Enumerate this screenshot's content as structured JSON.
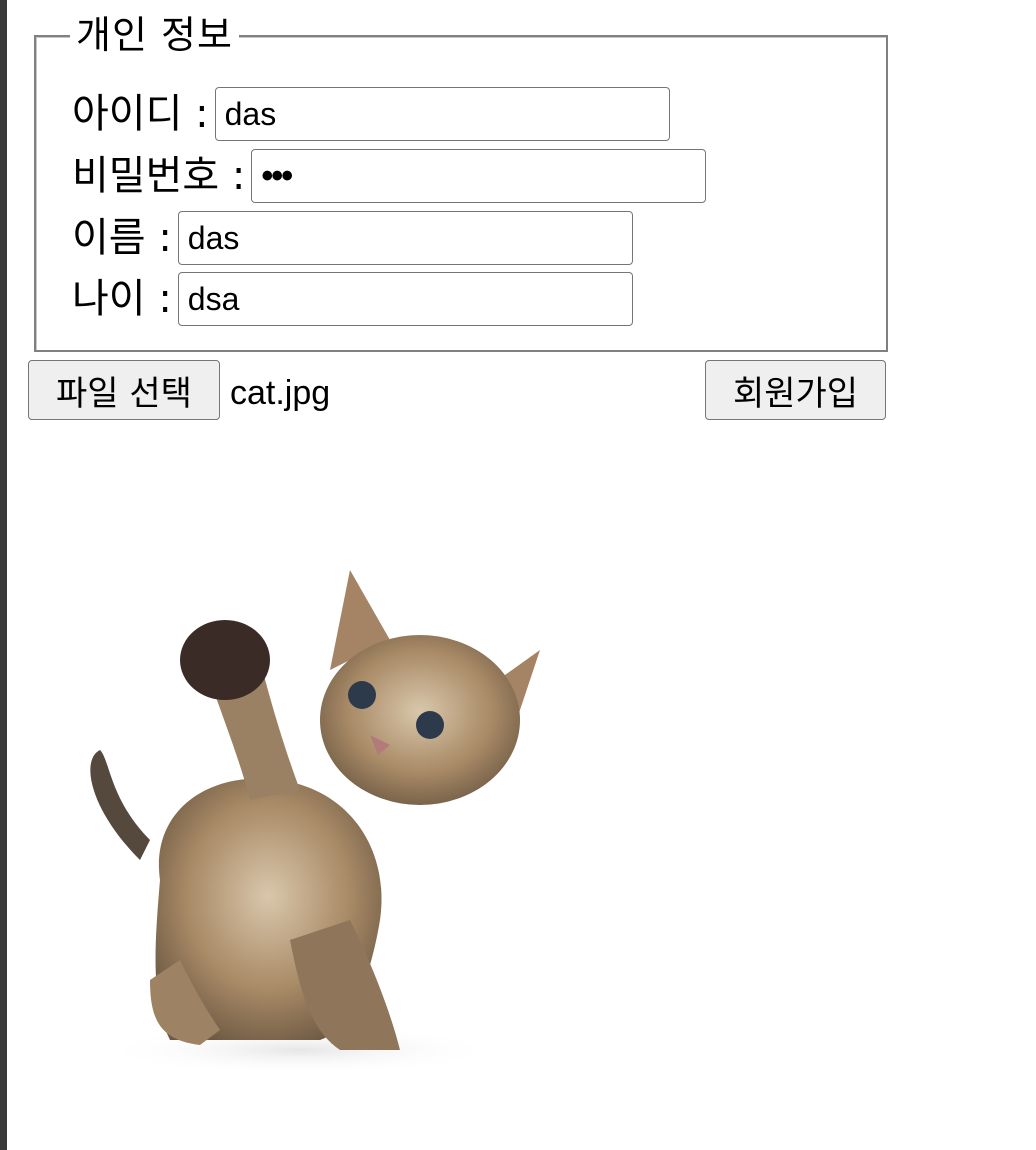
{
  "form": {
    "legend": "개인 정보",
    "fields": [
      {
        "label": "아이디 :",
        "value": "das",
        "type": "text"
      },
      {
        "label": "비밀번호 :",
        "value": "•••",
        "type": "password"
      },
      {
        "label": "이름 :",
        "value": "das",
        "type": "text"
      },
      {
        "label": "나이 :",
        "value": "dsa",
        "type": "text"
      }
    ]
  },
  "file_upload": {
    "button_label": "파일 선택",
    "selected_file": "cat.jpg"
  },
  "submit": {
    "label": "회원가입"
  },
  "preview": {
    "subject": "kitten photo"
  }
}
